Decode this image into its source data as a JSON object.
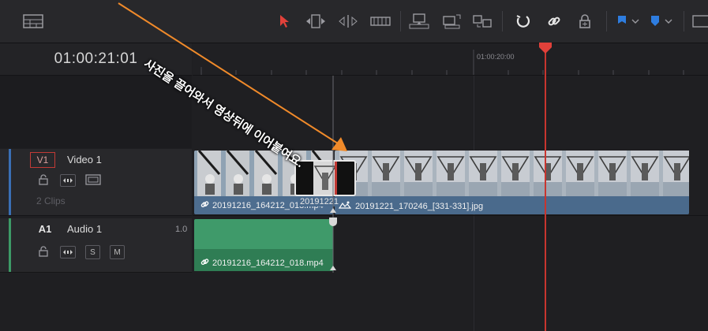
{
  "timecode": "01:00:21:01",
  "ruler": {
    "mark_label": "01:00:20:00"
  },
  "annotation": {
    "text": "사진을 끌어와서 영상뒤에 이어붙여요."
  },
  "tracks": {
    "video": {
      "badge": "V1",
      "name": "Video 1",
      "clips_count": "2 Clips"
    },
    "audio": {
      "badge": "A1",
      "name": "Audio 1",
      "level": "1.0",
      "solo": "S",
      "mute": "M"
    }
  },
  "clips": {
    "video_clip_1": {
      "name": "20191216_164212_018.mp4"
    },
    "photo_clip": {
      "name": "20191221_170246_[331-331].jpg"
    },
    "drag_preview": {
      "name": "20191221"
    },
    "audio_clip": {
      "name": "20191216_164212_018.mp4"
    }
  },
  "colors": {
    "accent_red": "#e2413a",
    "video_clip": "#4a6a8c",
    "audio_clip": "#3f9a6a",
    "flag_blue": "#2e7de0",
    "annotation_arrow": "#f08a2a"
  },
  "icons": [
    "layout-icon",
    "selection-pointer-icon",
    "trim-edit-icon",
    "dynamic-trim-icon",
    "blade-icon",
    "insert-clip-icon",
    "overwrite-clip-icon",
    "replace-clip-icon",
    "snapping-icon",
    "linked-selection-icon",
    "position-lock-icon",
    "flag-icon",
    "marker-icon",
    "more-icon"
  ]
}
